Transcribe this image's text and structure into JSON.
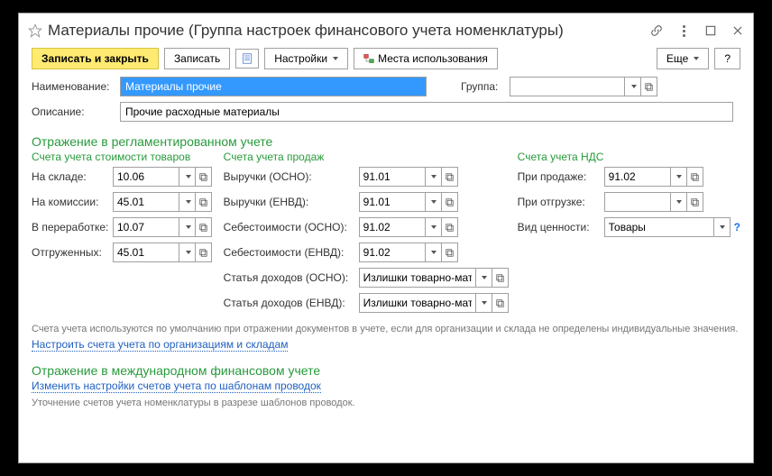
{
  "window": {
    "title": "Материалы прочие (Группа настроек финансового учета номенклатуры)"
  },
  "toolbar": {
    "save_close": "Записать и закрыть",
    "save": "Записать",
    "settings": "Настройки",
    "usage": "Места использования",
    "more": "Еще",
    "help": "?"
  },
  "fields": {
    "name_label": "Наименование:",
    "name_value": "Материалы прочие",
    "group_label": "Группа:",
    "group_value": "",
    "description_label": "Описание:",
    "description_value": "Прочие расходные материалы"
  },
  "section_reg": "Отражение в регламентированном учете",
  "subsection_cost": "Счета учета стоимости товаров",
  "subsection_sales": "Счета учета продаж",
  "subsection_vat": "Счета учета НДС",
  "cost": {
    "on_stock_label": "На складе:",
    "on_stock_value": "10.06",
    "commission_label": "На комиссии:",
    "commission_value": "45.01",
    "processing_label": "В переработке:",
    "processing_value": "10.07",
    "shipped_label": "Отгруженных:",
    "shipped_value": "45.01"
  },
  "sales": {
    "revenue_osno_label": "Выручки (ОСНО):",
    "revenue_osno_value": "91.01",
    "revenue_envd_label": "Выручки (ЕНВД):",
    "revenue_envd_value": "91.01",
    "cost_osno_label": "Себестоимости (ОСНО):",
    "cost_osno_value": "91.02",
    "cost_envd_label": "Себестоимости (ЕНВД):",
    "cost_envd_value": "91.02",
    "income_osno_label": "Статья доходов (ОСНО):",
    "income_osno_value": "Излишки товарно-материал",
    "income_envd_label": "Статья доходов (ЕНВД):",
    "income_envd_value": "Излишки товарно-материал"
  },
  "vat": {
    "on_sale_label": "При продаже:",
    "on_sale_value": "91.02",
    "on_ship_label": "При отгрузке:",
    "on_ship_value": "",
    "value_type_label": "Вид ценности:",
    "value_type_value": "Товары"
  },
  "notes": {
    "accounts_note": "Счета учета используются по умолчанию при отражении документов в учете, если для организации и склада не определены индивидуальные значения.",
    "accounts_link": "Настроить счета учета по организациям и складам",
    "section_intl": "Отражение в международном финансовом учете",
    "intl_link": "Изменить настройки счетов учета по шаблонам проводок",
    "intl_note": "Уточнение счетов учета номенклатуры в разрезе шаблонов проводок."
  }
}
